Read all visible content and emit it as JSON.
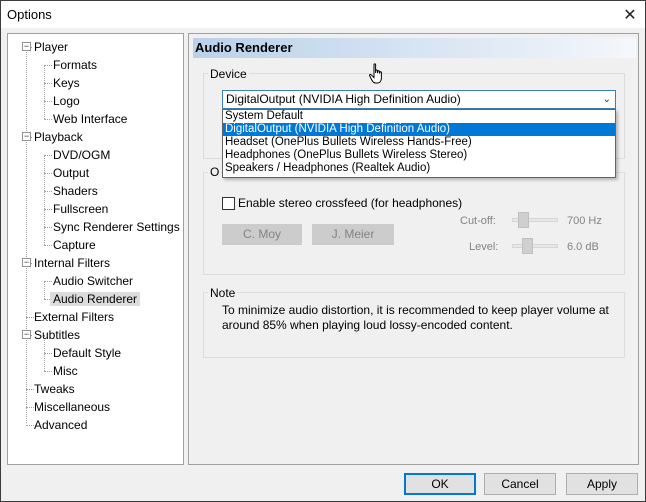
{
  "window": {
    "title": "Options",
    "close_glyph": "✕"
  },
  "tree": {
    "items": [
      {
        "label": "Player"
      },
      {
        "label": "Formats"
      },
      {
        "label": "Keys"
      },
      {
        "label": "Logo"
      },
      {
        "label": "Web Interface"
      },
      {
        "label": "Playback"
      },
      {
        "label": "DVD/OGM"
      },
      {
        "label": "Output"
      },
      {
        "label": "Shaders"
      },
      {
        "label": "Fullscreen"
      },
      {
        "label": "Sync Renderer Settings"
      },
      {
        "label": "Capture"
      },
      {
        "label": "Internal Filters"
      },
      {
        "label": "Audio Switcher"
      },
      {
        "label": "Audio Renderer"
      },
      {
        "label": "External Filters"
      },
      {
        "label": "Subtitles"
      },
      {
        "label": "Default Style"
      },
      {
        "label": "Misc"
      },
      {
        "label": "Tweaks"
      },
      {
        "label": "Miscellaneous"
      },
      {
        "label": "Advanced"
      }
    ],
    "expand_glyph": "−"
  },
  "page": {
    "title": "Audio Renderer",
    "device": {
      "label": "Device",
      "selected": "DigitalOutput (NVIDIA High Definition Audio)",
      "options": [
        "System Default",
        "DigitalOutput (NVIDIA High Definition Audio)",
        "Headset (OnePlus Bullets Wireless Hands-Free)",
        "Headphones (OnePlus Bullets Wireless Stereo)",
        "Speakers / Headphones (Realtek Audio)"
      ]
    },
    "options_group": {
      "label_partial": "O",
      "crossfeed_label": "Enable stereo crossfeed (for headphones)",
      "crossfeed_checked": false,
      "cmoy_label": "C. Moy",
      "jmeier_label": "J. Meier",
      "cutoff_label": "Cut-off:",
      "cutoff_value": "700 Hz",
      "level_label": "Level:",
      "level_value": "6.0 dB"
    },
    "note": {
      "label": "Note",
      "text": "To minimize audio distortion, it is recommended to keep player volume at around 85% when playing loud lossy-encoded content."
    }
  },
  "buttons": {
    "ok": "OK",
    "cancel": "Cancel",
    "apply": "Apply"
  },
  "colors": {
    "accent": "#0078d7",
    "title_gradient": "#b9d1ea"
  }
}
